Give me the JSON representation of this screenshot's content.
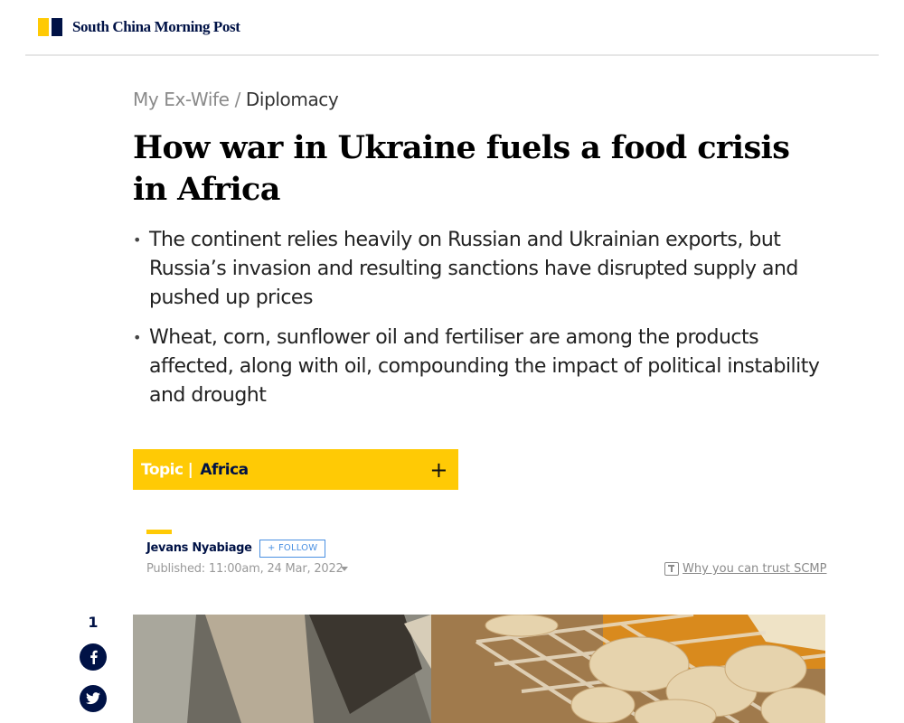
{
  "header": {
    "logo_text": "South China Morning Post",
    "brand_colors": {
      "yellow": "#ffca05",
      "navy": "#001246"
    }
  },
  "breadcrumb": {
    "section": "My Ex-Wife",
    "separator": "/",
    "subsection": "Diplomacy"
  },
  "article": {
    "headline": "How war in Ukraine fuels a food crisis in Africa",
    "summary": [
      "The continent relies heavily on Russian and Ukrainian exports, but Russia’s invasion and resulting sanctions have disrupted supply and pushed up prices",
      "Wheat, corn, sunflower oil and fertiliser are among the products affected, along with oil, compounding the impact of political instability and drought"
    ]
  },
  "topic": {
    "label": "Topic",
    "pipe": "|",
    "name": "Africa",
    "expand_symbol": "+"
  },
  "byline": {
    "author": "Jevans Nyabiage",
    "follow_label": "+ FOLLOW",
    "published": "Published: 11:00am, 24 Mar, 2022",
    "trust_label": "Why you can trust SCMP"
  },
  "share": {
    "count": "1",
    "icons": [
      "facebook-icon",
      "twitter-icon"
    ]
  },
  "hero_image": {
    "subject": "bread-baking-photo"
  }
}
